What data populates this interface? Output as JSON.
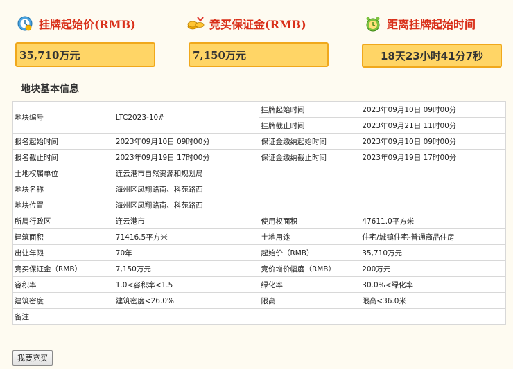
{
  "top": {
    "start_price_label": "挂牌起始价(RMB)",
    "start_price_value": "35,710万元",
    "deposit_label": "竞买保证金(RMB)",
    "deposit_value": "7,150万元",
    "countdown_label": "距离挂牌起始时间",
    "countdown_value": "18天23小时41分7秒"
  },
  "section_title": "地块基本信息",
  "table": {
    "parcel_no_label": "地块编号",
    "parcel_no_value": "LTC2023-10#",
    "listing_start_label": "挂牌起始时间",
    "listing_start_value": "2023年09月10日 09时00分",
    "listing_end_label": "挂牌截止时间",
    "listing_end_value": "2023年09月21日 11时00分",
    "reg_start_label": "报名起始时间",
    "reg_start_value": "2023年09月10日 09时00分",
    "deposit_start_label": "保证金缴纳起始时间",
    "deposit_start_value": "2023年09月10日 09时00分",
    "reg_end_label": "报名截止时间",
    "reg_end_value": "2023年09月19日 17时00分",
    "deposit_end_label": "保证金缴纳截止时间",
    "deposit_end_value": "2023年09月19日 17时00分",
    "owner_label": "土地权属单位",
    "owner_value": "连云港市自然资源和规划局",
    "name_label": "地块名称",
    "name_value": "海州区凤翔路南、科苑路西",
    "location_label": "地块位置",
    "location_value": "海州区凤翔路南、科苑路西",
    "district_label": "所属行政区",
    "district_value": "连云港市",
    "use_area_label": "使用权面积",
    "use_area_value": "47611.0平方米",
    "build_area_label": "建筑面积",
    "build_area_value": "71416.5平方米",
    "land_use_label": "土地用途",
    "land_use_value": "住宅/城镇住宅-普通商品住房",
    "term_label": "出让年限",
    "term_value": "70年",
    "start_price_label": "起始价（RMB）",
    "start_price_value": "35,710万元",
    "deposit_label": "竞买保证金（RMB）",
    "deposit_value": "7,150万元",
    "increment_label": "竞价增价幅度（RMB）",
    "increment_value": "200万元",
    "far_label": "容积率",
    "far_value": "1.0<容积率<1.5",
    "green_label": "绿化率",
    "green_value": "30.0%<绿化率",
    "density_label": "建筑密度",
    "density_value": "建筑密度<26.0%",
    "height_label": "限高",
    "height_value": "限高<36.0米",
    "remark_label": "备注",
    "remark_value": ""
  },
  "bid_button": "我要竞买"
}
